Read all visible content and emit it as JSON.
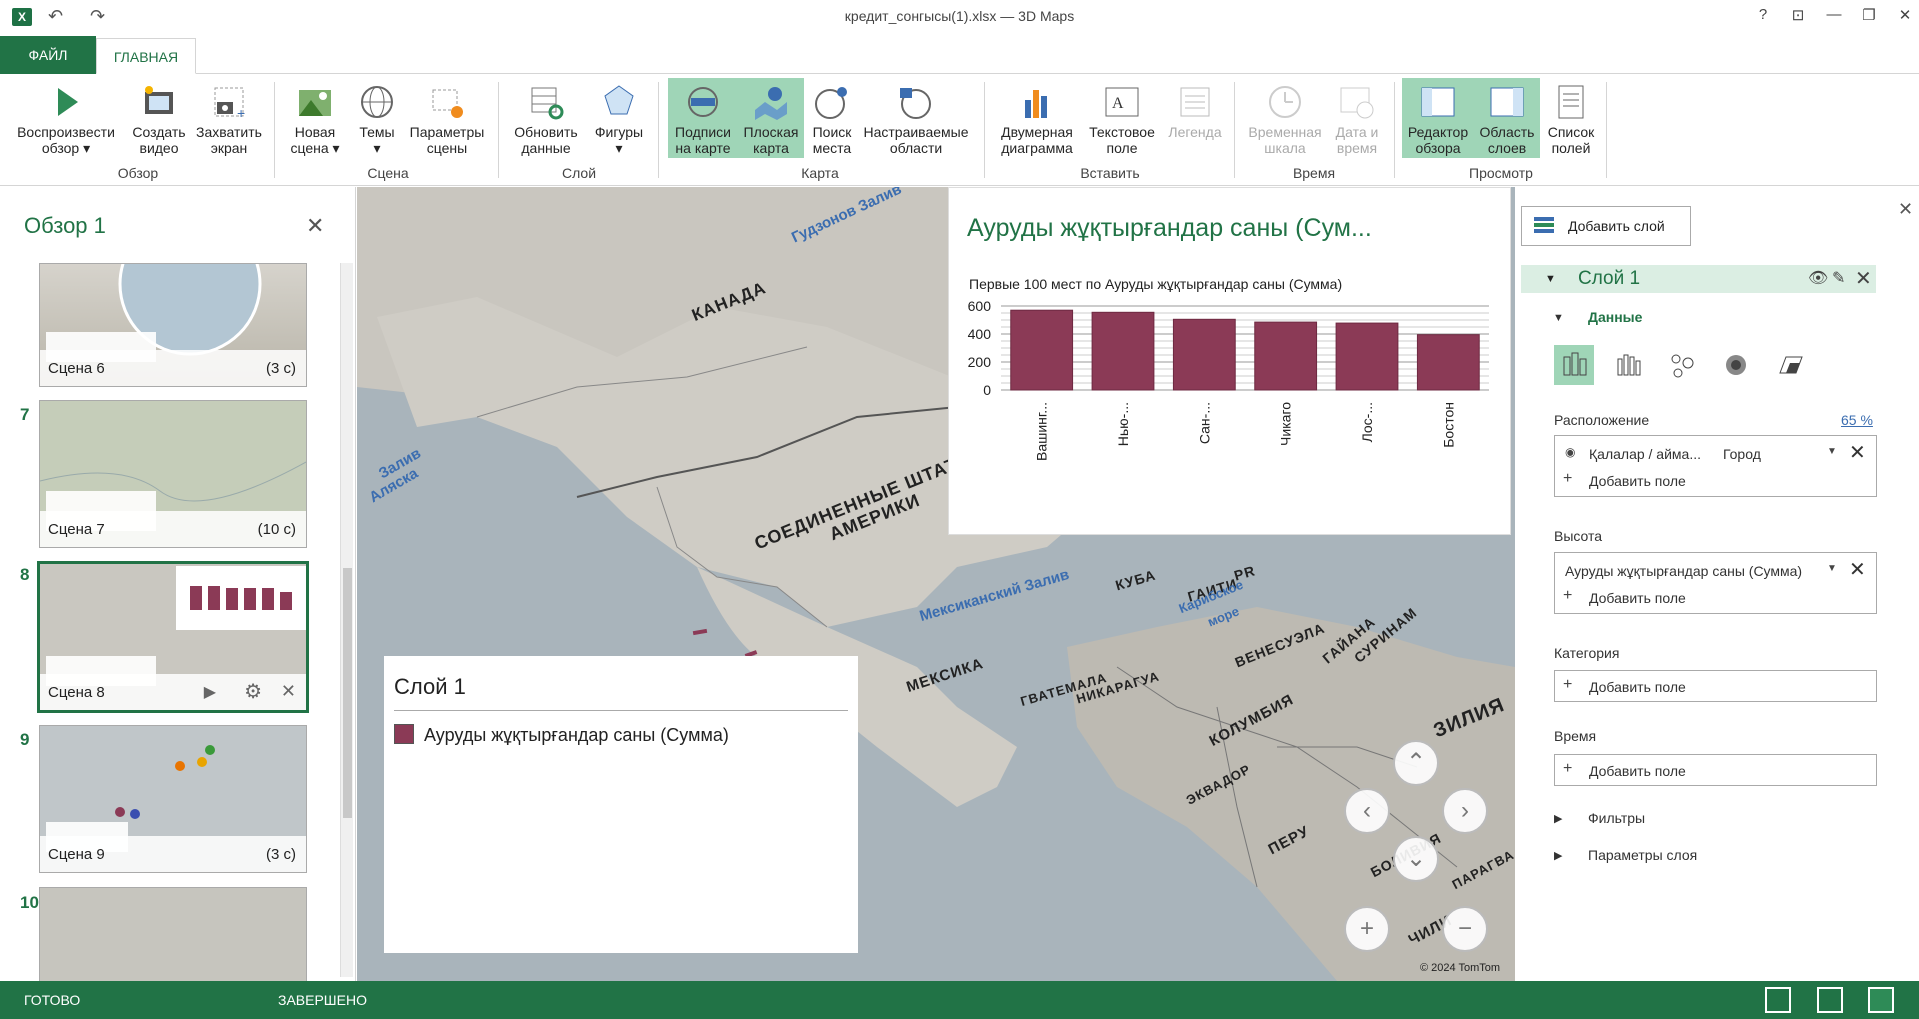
{
  "window": {
    "title": "кредит_сонгысы(1).xlsx — 3D Maps",
    "help": "?"
  },
  "tabs": {
    "file": "ФАЙЛ",
    "home": "ГЛАВНАЯ"
  },
  "ribbon": {
    "buttons": {
      "play_tour": "Воспроизвести обзор",
      "create_video": "Создать видео",
      "capture_screen": "Захватить экран",
      "new_scene": "Новая сцена",
      "themes": "Темы",
      "scene_options": "Параметры сцены",
      "refresh_data": "Обновить данные",
      "shapes": "Фигуры",
      "map_labels": "Подписи на карте",
      "flat_map": "Плоская карта",
      "find_location": "Поиск места",
      "custom_regions": "Настраиваемые области",
      "chart_2d": "Двумерная диаграмма",
      "text_box": "Текстовое поле",
      "legend": "Легенда",
      "timeline": "Временная шкала",
      "date_time": "Дата и время",
      "tour_editor": "Редактор обзора",
      "layer_pane": "Область слоев",
      "field_list": "Список полей"
    },
    "groups": {
      "tour": "Обзор",
      "scene": "Сцена",
      "layer": "Слой",
      "map": "Карта",
      "insert": "Вставить",
      "time": "Время",
      "view": "Просмотр"
    }
  },
  "tour_panel": {
    "title": "Обзор 1",
    "scenes": [
      {
        "num": "",
        "name": "Сцена 6",
        "duration": "(3 с)"
      },
      {
        "num": "7",
        "name": "Сцена 7",
        "duration": "(10 с)"
      },
      {
        "num": "8",
        "name": "Сцена 8",
        "duration": ""
      },
      {
        "num": "9",
        "name": "Сцена 9",
        "duration": "(3 с)"
      },
      {
        "num": "10",
        "name": "",
        "duration": ""
      }
    ]
  },
  "map": {
    "labels": {
      "canada": "КАНАДА",
      "usa_1": "СОЕДИНЕННЫЕ ШТАТЫ",
      "usa_2": "АМЕРИКИ",
      "mexico": "МЕКСИКА",
      "cuba": "КУБА",
      "haiti": "ГАИТИ",
      "pr": "PR",
      "guatemala": "ГВАТЕМАЛА",
      "nicaragua": "НИКАРАГУА",
      "venezuela": "ВЕНЕСУЭЛА",
      "guyana": "ГАЙАНА",
      "suriname": "СУРИНАМ",
      "colombia": "КОЛУМБИЯ",
      "ecuador": "ЭКВАДОР",
      "peru": "ПЕРУ",
      "bolivia": "БОЛИВИЯ",
      "paraguay": "ПАРАГВА",
      "chile": "ЧИЛИ",
      "brazil": "ЗИЛИЯ"
    },
    "water": {
      "hudson": "Гудзонов Залив",
      "alaska_1": "Залив",
      "alaska_2": "Аляска",
      "gulf_mexico": "Мексиканский Залив",
      "caribbean_1": "Карибское",
      "caribbean_2": "море"
    },
    "copyright": "© 2024 TomTom"
  },
  "chart_card": {
    "title": "Ауруды жұқтырғандар саны (Сум...",
    "subtitle": "Первые 100 мест   по Ауруды жұқтырғандар саны (Сумма)"
  },
  "chart_data": {
    "type": "bar",
    "categories": [
      "Вашинг...",
      "Нью-...",
      "Сан-...",
      "Чикаго",
      "Лос-...",
      "Бостон"
    ],
    "values": [
      570,
      555,
      505,
      485,
      478,
      395
    ],
    "ylim": [
      0,
      600
    ],
    "yticks": [
      "0",
      "200",
      "400",
      "600"
    ],
    "bar_color": "#8b3a56",
    "grid": true
  },
  "legend_card": {
    "title": "Слой 1",
    "item": "Ауруды жұқтырғандар саны (Сумма)",
    "color": "#8b3a56"
  },
  "layer_pane": {
    "add_layer": "Добавить слой",
    "layer_name": "Слой 1",
    "data_section": "Данные",
    "location_label": "Расположение",
    "location_pct": "65 %",
    "location_field": "Қалалар / айма...",
    "location_type": "Город",
    "add_field": "Добавить поле",
    "height_label": "Высота",
    "height_field": "Ауруды жұқтырғандар саны (Сумма)",
    "category_label": "Категория",
    "time_label": "Время",
    "filters": "Фильтры",
    "layer_options": "Параметры слоя"
  },
  "status": {
    "ready": "ГОТОВО",
    "done": "ЗАВЕРШЕНО"
  },
  "colors": {
    "accent": "#217346",
    "active_btn": "#9fd5b7"
  }
}
